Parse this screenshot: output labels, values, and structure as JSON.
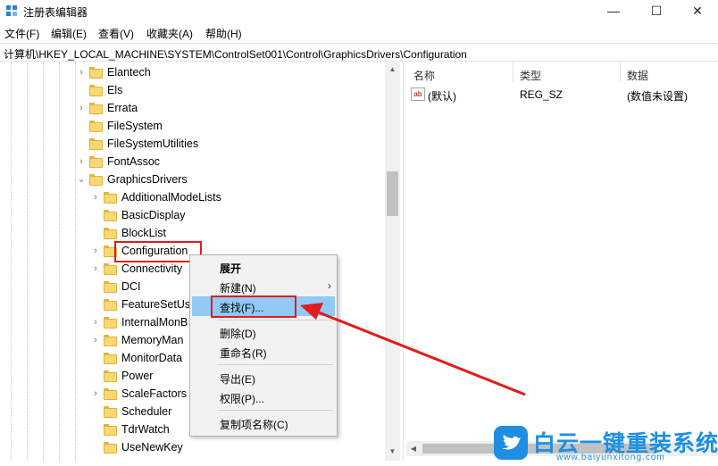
{
  "window": {
    "title": "注册表编辑器",
    "min": "—",
    "max": "☐",
    "close": "✕"
  },
  "menu": [
    "文件(F)",
    "编辑(E)",
    "查看(V)",
    "收藏夹(A)",
    "帮助(H)"
  ],
  "address": "计算机\\HKEY_LOCAL_MACHINE\\SYSTEM\\ControlSet001\\Control\\GraphicsDrivers\\Configuration",
  "tree": {
    "top_nodes": [
      "Elantech",
      "Els",
      "Errata",
      "FileSystem",
      "FileSystemUtilities",
      "FontAssoc",
      "GraphicsDrivers"
    ],
    "child_nodes": [
      "AdditionalModeLists",
      "BasicDisplay",
      "BlockList",
      "Configuration",
      "Connectivity",
      "DCI",
      "FeatureSetUs",
      "InternalMonB",
      "MemoryMan",
      "MonitorData",
      "Power",
      "ScaleFactors",
      "Scheduler",
      "TdrWatch",
      "UseNewKey"
    ]
  },
  "list": {
    "headers": {
      "name": "名称",
      "type": "类型",
      "data": "数据"
    },
    "rows": [
      {
        "icon": "ab",
        "name": "(默认)",
        "type": "REG_SZ",
        "data": "(数值未设置)"
      }
    ]
  },
  "context_menu": {
    "expand": "展开",
    "new": "新建(N)",
    "find": "查找(F)...",
    "delete": "删除(D)",
    "rename": "重命名(R)",
    "export": "导出(E)",
    "permissions": "权限(P)...",
    "copy_key_name": "复制项名称(C)"
  },
  "watermark": {
    "cn": "白云一键重装系统",
    "en": "www.baiyunxitong.com"
  },
  "colors": {
    "highlight": "#91c9f7",
    "annotation_red": "#e11b1b",
    "folder": "#f8d775",
    "watermark_blue": "#1d8fe2"
  }
}
